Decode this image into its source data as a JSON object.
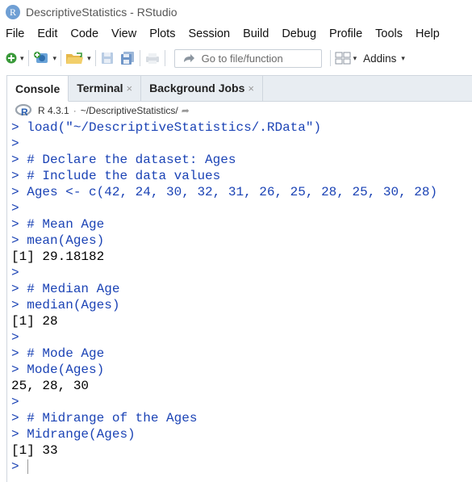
{
  "window": {
    "title": "DescriptiveStatistics - RStudio",
    "icon_letter": "R"
  },
  "menu": [
    "File",
    "Edit",
    "Code",
    "View",
    "Plots",
    "Session",
    "Build",
    "Debug",
    "Profile",
    "Tools",
    "Help"
  ],
  "toolbar": {
    "goto_placeholder": "Go to file/function",
    "addins_label": "Addins"
  },
  "tabs": [
    {
      "label": "Console",
      "closable": false
    },
    {
      "label": "Terminal",
      "closable": true
    },
    {
      "label": "Background Jobs",
      "closable": true
    }
  ],
  "tab_close_glyph": "×",
  "pathbar": {
    "r_version": "R 4.3.1",
    "separator": "·",
    "path": "~/DescriptiveStatistics/"
  },
  "prompt_symbol": ">",
  "console_lines": [
    {
      "type": "input",
      "text": "load(\"~/DescriptiveStatistics/.RData\")"
    },
    {
      "type": "input",
      "text": ""
    },
    {
      "type": "input",
      "text": "# Declare the dataset: Ages"
    },
    {
      "type": "input",
      "text": "# Include the data values"
    },
    {
      "type": "input",
      "text": "Ages <- c(42, 24, 30, 32, 31, 26, 25, 28, 25, 30, 28)"
    },
    {
      "type": "input",
      "text": ""
    },
    {
      "type": "input",
      "text": "# Mean Age"
    },
    {
      "type": "input",
      "text": "mean(Ages)"
    },
    {
      "type": "output",
      "text": "[1] 29.18182"
    },
    {
      "type": "input",
      "text": ""
    },
    {
      "type": "input",
      "text": "# Median Age"
    },
    {
      "type": "input",
      "text": "median(Ages)"
    },
    {
      "type": "output",
      "text": "[1] 28"
    },
    {
      "type": "input",
      "text": ""
    },
    {
      "type": "input",
      "text": "# Mode Age"
    },
    {
      "type": "input",
      "text": "Mode(Ages)"
    },
    {
      "type": "output",
      "text": "25, 28, 30"
    },
    {
      "type": "input",
      "text": ""
    },
    {
      "type": "input",
      "text": "# Midrange of the Ages"
    },
    {
      "type": "input",
      "text": "Midrange(Ages)"
    },
    {
      "type": "output",
      "text": "[1] 33"
    },
    {
      "type": "cursor",
      "text": ""
    }
  ],
  "colors": {
    "prompt": "#1b43b5",
    "output": "#000000",
    "tab_bar": "#e8edf2",
    "accent_green": "#3a9a3a"
  }
}
